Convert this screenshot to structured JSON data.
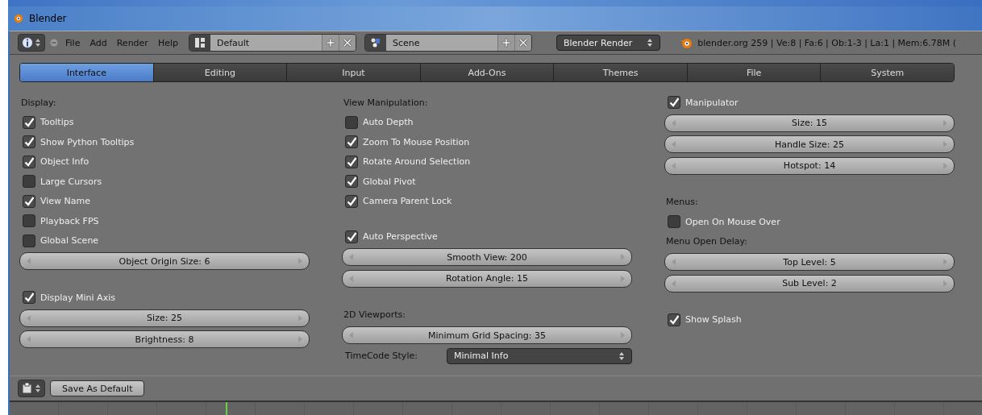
{
  "window": {
    "title": "Blender"
  },
  "header": {
    "menus": [
      "File",
      "Add",
      "Render",
      "Help"
    ],
    "layout": "Default",
    "scene": "Scene",
    "engine": "Blender Render",
    "stats": "blender.org 259 | Ve:8 | Fa:6 | Ob:1-3 | La:1 | Mem:6.78M ("
  },
  "tabs": [
    {
      "label": "Interface",
      "selected": true
    },
    {
      "label": "Editing",
      "selected": false
    },
    {
      "label": "Input",
      "selected": false
    },
    {
      "label": "Add-Ons",
      "selected": false
    },
    {
      "label": "Themes",
      "selected": false
    },
    {
      "label": "File",
      "selected": false
    },
    {
      "label": "System",
      "selected": false
    }
  ],
  "columns": [
    [
      {
        "items": [
          {
            "kind": "heading",
            "label": "Display:"
          },
          {
            "kind": "checkbox",
            "label": "Tooltips",
            "checked": true
          },
          {
            "kind": "checkbox",
            "label": "Show Python Tooltips",
            "checked": true
          },
          {
            "kind": "checkbox",
            "label": "Object Info",
            "checked": true
          },
          {
            "kind": "checkbox",
            "label": "Large Cursors",
            "checked": false
          },
          {
            "kind": "checkbox",
            "label": "View Name",
            "checked": true
          },
          {
            "kind": "checkbox",
            "label": "Playback FPS",
            "checked": false
          },
          {
            "kind": "checkbox",
            "label": "Global Scene",
            "checked": false
          },
          {
            "kind": "slider",
            "label": "Object Origin Size: 6"
          }
        ]
      },
      {
        "items": [
          {
            "kind": "checkbox",
            "label": "Display Mini Axis",
            "checked": true
          },
          {
            "kind": "slider",
            "label": "Size: 25"
          },
          {
            "kind": "slider",
            "label": "Brightness: 8"
          }
        ]
      }
    ],
    [
      {
        "items": [
          {
            "kind": "heading",
            "label": "View Manipulation:"
          },
          {
            "kind": "checkbox",
            "label": "Auto Depth",
            "checked": false
          },
          {
            "kind": "checkbox",
            "label": "Zoom To Mouse Position",
            "checked": true
          },
          {
            "kind": "checkbox",
            "label": "Rotate Around Selection",
            "checked": true
          },
          {
            "kind": "checkbox",
            "label": "Global Pivot",
            "checked": true
          },
          {
            "kind": "checkbox",
            "label": "Camera Parent Lock",
            "checked": true
          }
        ]
      },
      {
        "items": [
          {
            "kind": "checkbox",
            "label": "Auto Perspective",
            "checked": true
          },
          {
            "kind": "slider",
            "label": "Smooth View: 200"
          },
          {
            "kind": "slider",
            "label": "Rotation Angle: 15"
          }
        ]
      },
      {
        "items": [
          {
            "kind": "heading",
            "label": "2D Viewports:"
          },
          {
            "kind": "slider",
            "label": "Minimum Grid Spacing: 35"
          },
          {
            "kind": "dropdown",
            "label": "TimeCode Style:",
            "value": "Minimal Info"
          }
        ]
      }
    ],
    [
      {
        "items": [
          {
            "kind": "checkbox",
            "label": "Manipulator",
            "checked": true
          },
          {
            "kind": "slider",
            "label": "Size: 15"
          },
          {
            "kind": "slider",
            "label": "Handle Size: 25"
          },
          {
            "kind": "slider",
            "label": "Hotspot: 14"
          }
        ]
      },
      {
        "items": [
          {
            "kind": "heading",
            "label": "Menus:"
          },
          {
            "kind": "checkbox",
            "label": "Open On Mouse Over",
            "checked": false
          },
          {
            "kind": "heading",
            "label": "Menu Open Delay:"
          },
          {
            "kind": "slider",
            "label": "Top Level: 5"
          },
          {
            "kind": "slider",
            "label": "Sub Level: 2"
          }
        ]
      },
      {
        "items": [
          {
            "kind": "checkbox",
            "label": "Show Splash",
            "checked": true
          }
        ]
      }
    ]
  ],
  "footer": {
    "button": "Save As Default"
  }
}
